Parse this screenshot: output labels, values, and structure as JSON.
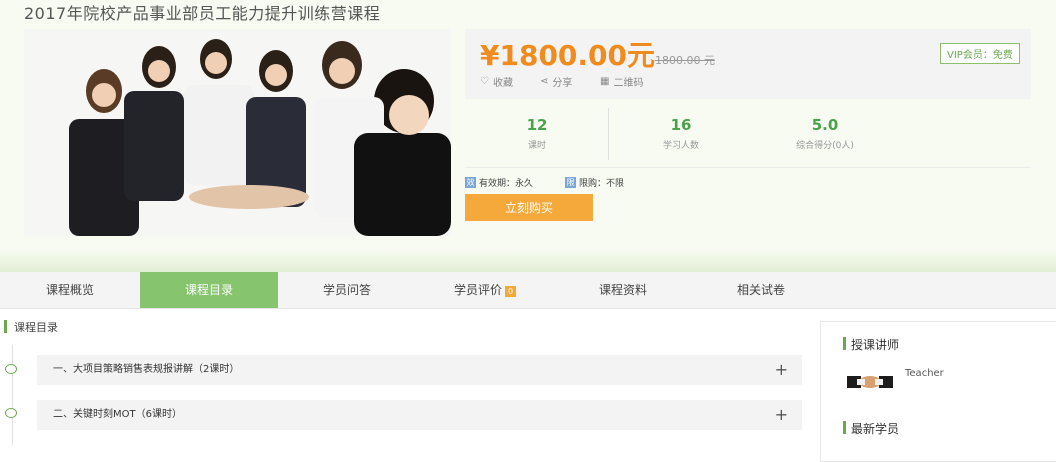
{
  "course": {
    "title": "2017年院校产品事业部员工能力提升训练营课程"
  },
  "price": {
    "current": "¥1800.00元",
    "original": "1800.00 元",
    "vip_label": "VIP会员：免费"
  },
  "actions": [
    {
      "icon": "heart-icon",
      "label": "收藏"
    },
    {
      "icon": "share-icon",
      "label": "分享"
    },
    {
      "icon": "qrcode-icon",
      "label": "二维码"
    }
  ],
  "stats": [
    {
      "value": "12",
      "label": "课时"
    },
    {
      "value": "16",
      "label": "学习人数"
    },
    {
      "value": "5.0",
      "label": "综合得分(0人)"
    }
  ],
  "meta": {
    "validity_tag": "效",
    "validity": "有效期：永久",
    "limit_tag": "限",
    "limit": "限购：不限"
  },
  "buy_button": "立刻购买",
  "tabs": [
    {
      "label": "课程概览"
    },
    {
      "label": "课程目录"
    },
    {
      "label": "学员问答"
    },
    {
      "label": "学员评价",
      "badge": "0"
    },
    {
      "label": "课程资料"
    },
    {
      "label": "相关试卷"
    }
  ],
  "catalog": {
    "heading": "课程目录",
    "chapters": [
      {
        "title": "一、大项目策略销售表规报讲解（2课时）"
      },
      {
        "title": "二、关键时刻MOT（6课时）"
      }
    ]
  },
  "sidebar": {
    "instructors_heading": "授课讲师",
    "teacher_name": "Teacher",
    "new_students_heading": "最新学员"
  },
  "colors": {
    "accent_green": "#86c56e",
    "price_orange": "#f08c1e",
    "buy_orange": "#f5a93a"
  }
}
